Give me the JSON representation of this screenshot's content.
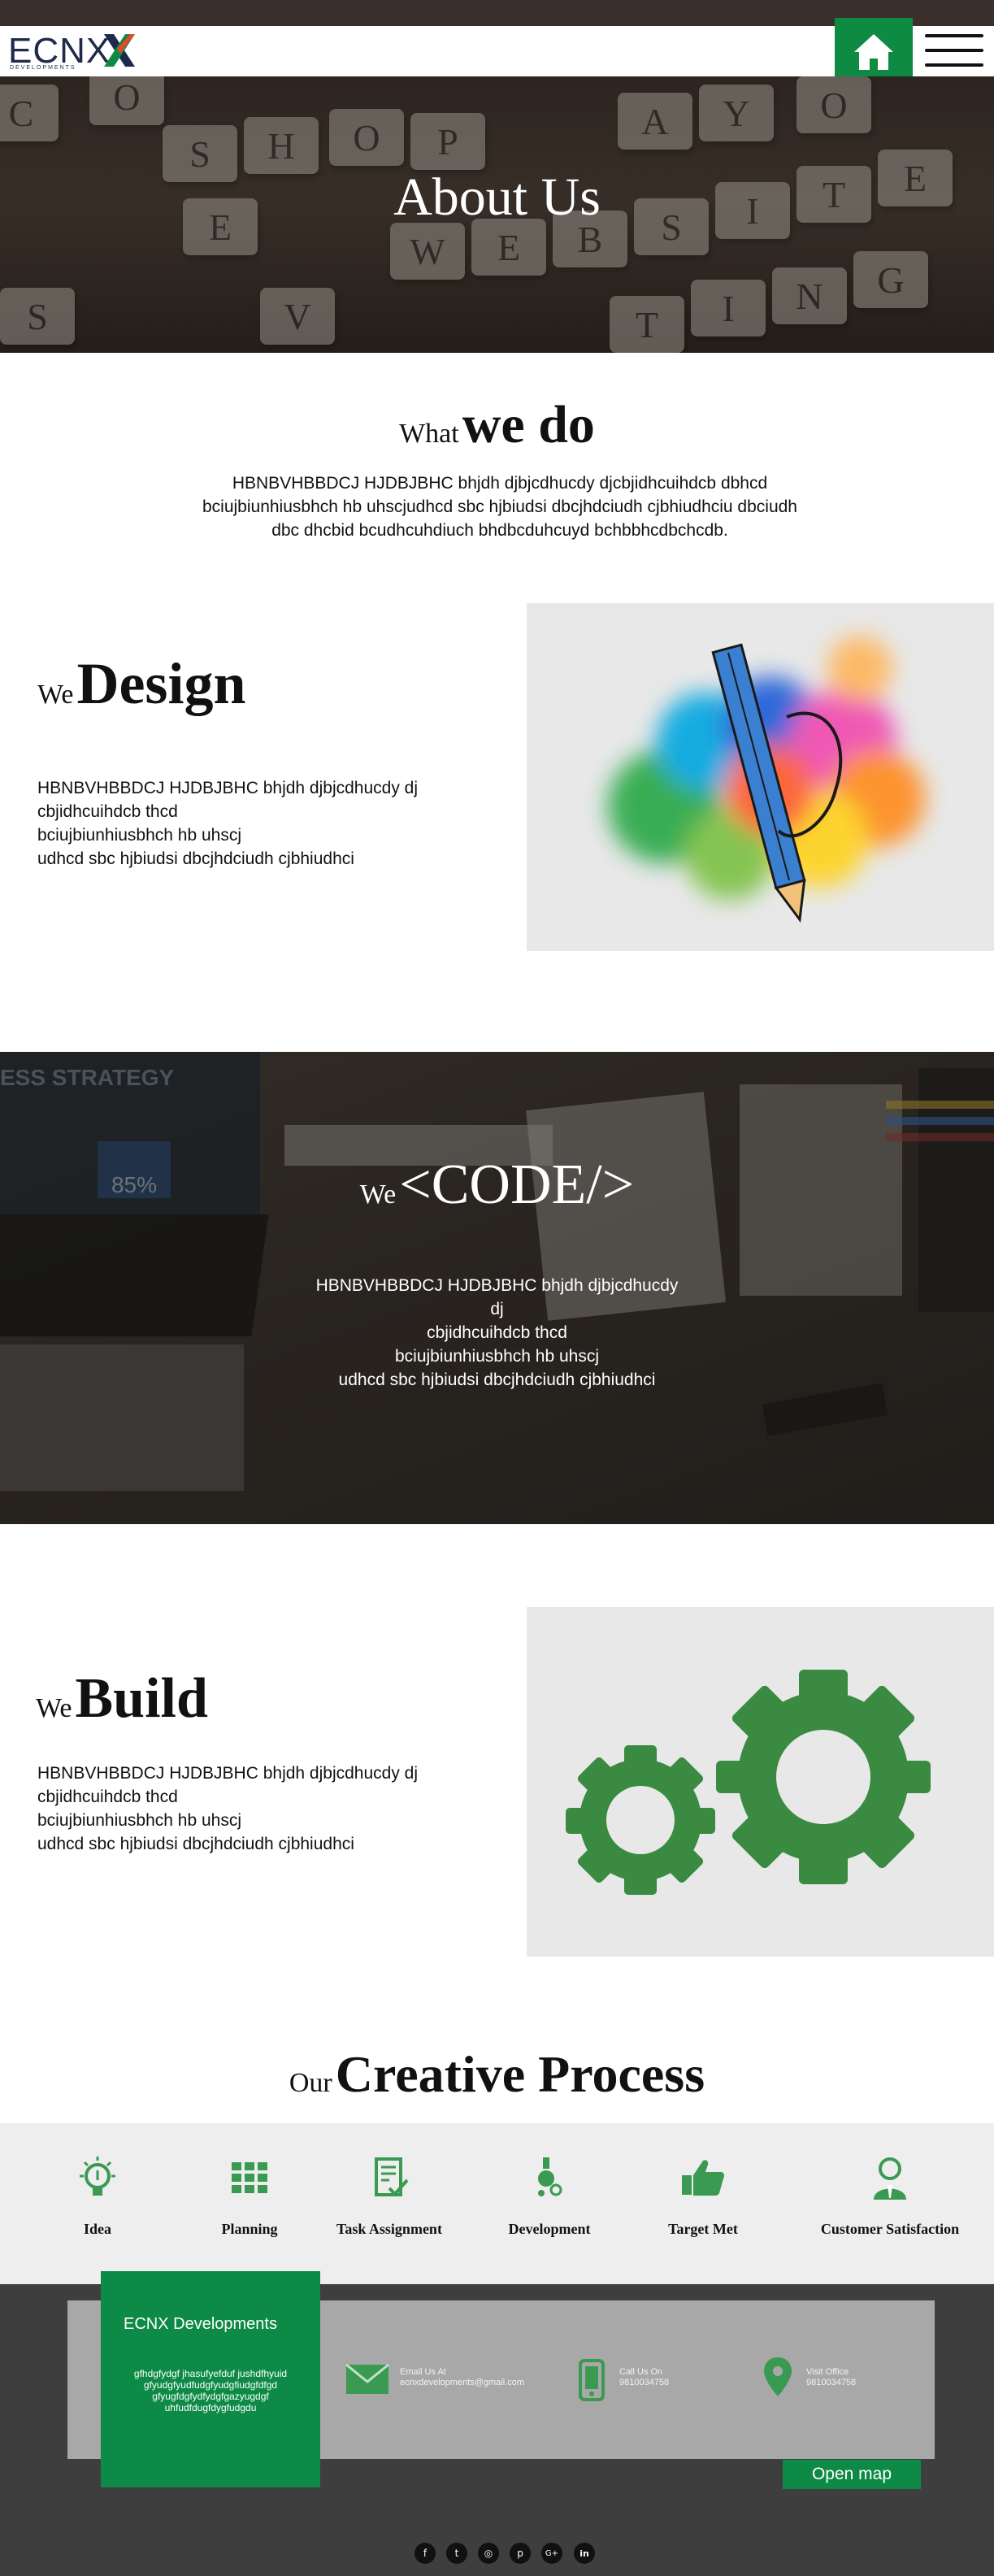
{
  "header": {
    "logo_text": "ECNX",
    "logo_sub": "DEVELOPMENTS",
    "home_icon": "home-icon",
    "menu_icon": "hamburger-menu-icon",
    "accent_color": "#0e8a43"
  },
  "hero": {
    "title": "About Us"
  },
  "what_we_do": {
    "small": "What",
    "big": "we do",
    "text": "HBNBVHBBDCJ HJDBJBHC bhjdh djbjcdhucdy djcbjidhcuihdcb dbhcd bciujbiunhiusbhch hb uhscjudhcd sbc hjbiudsi dbcjhdciudh   cjbhiudhciu dbciudh dbc dhcbid bcudhcuhdiuch bhdbcduhcuyd bchbbhcdbchcdb."
  },
  "design": {
    "small": "We",
    "big": "Design",
    "lines": [
      "HBNBVHBBDCJ HJDBJBHC bhjdh djbjcdhucdy dj",
      "cbjidhcuihdcb  thcd",
      "bciujbiunhiusbhch hb uhscj",
      "udhcd sbc hjbiudsi dbcjhdciudh   cjbhiudhci"
    ]
  },
  "code": {
    "small": "We",
    "big": "<CODE/>",
    "lines": [
      "HBNBVHBBDCJ HJDBJBHC bhjdh djbjcdhucdy dj",
      "cbjidhcuihdcb  thcd",
      "bciujbiunhiusbhch hb uhscj",
      "udhcd sbc hjbiudsi dbcjhdciudh   cjbhiudhci"
    ],
    "bg_text": "ESS STRATEGY",
    "bg_number": "85%"
  },
  "build": {
    "small": "We",
    "big": "Build",
    "lines": [
      "HBNBVHBBDCJ HJDBJBHC bhjdh djbjcdhucdy dj",
      "cbjidhcuihdcb  thcd",
      "bciujbiunhiusbhch hb uhscj",
      "udhcd sbc hjbiudsi dbcjhdciudh   cjbhiudhci"
    ]
  },
  "process": {
    "small": "Our",
    "big": "Creative Process",
    "steps": [
      {
        "label": "Idea",
        "icon": "lightbulb-icon"
      },
      {
        "label": "Planning",
        "icon": "grid-icon"
      },
      {
        "label": "Task Assignment",
        "icon": "checklist-icon"
      },
      {
        "label": "Development",
        "icon": "flask-icon"
      },
      {
        "label": "Target Met",
        "icon": "thumbs-up-icon"
      },
      {
        "label": "Customer Satisfaction",
        "icon": "customer-icon"
      }
    ]
  },
  "footer": {
    "company": "ECNX Developments",
    "about_lines": [
      "gfhdgfydgf jhasufyefduf jushdfhyuid",
      "gfyudgfyudfudgfyudgfiudgfdfgd",
      "gfyugfdgfydfydgfgazyugdgf",
      "uhfudfdugfdygfudgdu"
    ],
    "email_label": "Email Us At",
    "email_value": "ecnxdevelopments@gmail.com",
    "call_label": "Call Us On",
    "call_value": "9810034758",
    "visit_label": "Visit Office",
    "visit_value": "9810034758",
    "open_map": "Open map",
    "social": [
      "f",
      "t",
      "◎",
      "p",
      "G+",
      "in"
    ]
  }
}
